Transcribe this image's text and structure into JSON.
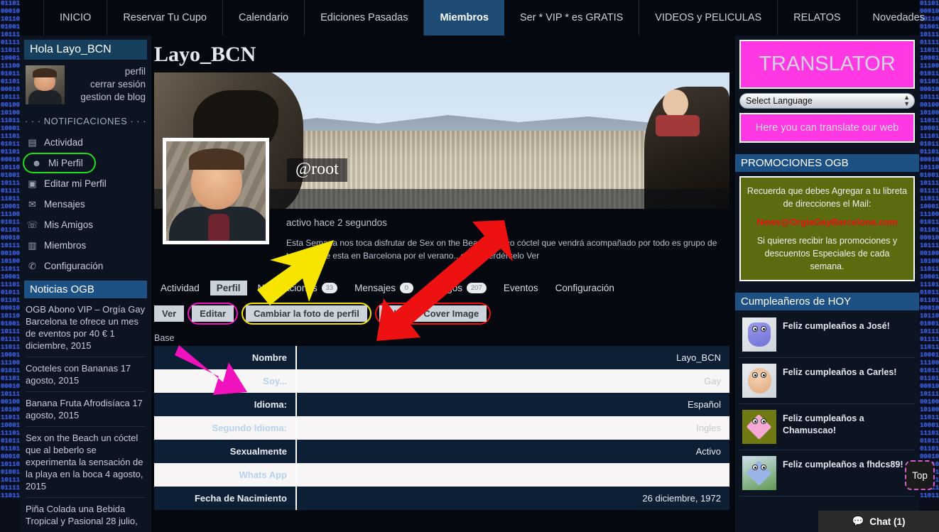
{
  "topnav": {
    "items": [
      {
        "label": "INICIO",
        "active": false
      },
      {
        "label": "Reservar Tu Cupo",
        "active": false
      },
      {
        "label": "Calendario",
        "active": false
      },
      {
        "label": "Ediciones Pasadas",
        "active": false
      },
      {
        "label": "Miembros",
        "active": true
      },
      {
        "label": "Ser * VIP * es GRATIS",
        "active": false
      },
      {
        "label": "VIDEOS y PELICULAS",
        "active": false
      },
      {
        "label": "RELATOS",
        "active": false
      },
      {
        "label": "Novedades",
        "active": false
      }
    ]
  },
  "sidebar": {
    "greeting": "Hola Layo_BCN",
    "user_links": [
      "perfil",
      "cerrar sesión",
      "gestion de blog"
    ],
    "notif_header": "· · · NOTIFICACIONES · · ·",
    "nav": [
      {
        "label": "Actividad",
        "icon": "list-icon",
        "highlight": false
      },
      {
        "label": "Mi Perfil",
        "icon": "user-icon",
        "highlight": true
      },
      {
        "label": "Editar mi Perfil",
        "icon": "id-card-icon",
        "highlight": false
      },
      {
        "label": "Mensajes",
        "icon": "envelope-icon",
        "highlight": false
      },
      {
        "label": "Mis Amigos",
        "icon": "users-icon",
        "highlight": false
      },
      {
        "label": "Miembros",
        "icon": "contacts-icon",
        "highlight": false
      },
      {
        "label": "Configuración",
        "icon": "key-icon",
        "highlight": false
      }
    ],
    "news_header": "Noticias OGB",
    "news": [
      "OGB Abono VIP – Orgía Gay Barcelona te ofrece un mes de eventos por 40 € 1 diciembre, 2015",
      "Cocteles con Bananas 17 agosto, 2015",
      "Banana Fruta Afrodisíaca 17 agosto, 2015",
      "Sex on the Beach un cóctel que al beberlo se experimenta la sensación de la playa en la boca 4 agosto, 2015",
      "Piña Colada una Bebida Tropical y Pasional 28 julio,"
    ]
  },
  "main": {
    "page_title": "Layo_BCN",
    "handle": "@root",
    "active_since": "activo hace 2 segundos",
    "bio": "Esta Semana nos toca disfrutar de Sex on the Beach un rico cóctel que vendrá acompañado por todo es grupo de turistas que esta en Barcelona por el verano.. como perdérselo Ver",
    "tabs": [
      {
        "label": "Actividad",
        "selected": false,
        "badge": null
      },
      {
        "label": "Perfil",
        "selected": true,
        "badge": null
      },
      {
        "label": "Notificaciones",
        "selected": false,
        "badge": "33"
      },
      {
        "label": "Mensajes",
        "selected": false,
        "badge": "0"
      },
      {
        "label": "Amigos",
        "selected": false,
        "badge": "207"
      },
      {
        "label": "Eventos",
        "selected": false,
        "badge": null
      },
      {
        "label": "Configuración",
        "selected": false,
        "badge": null
      }
    ],
    "subbar": [
      {
        "label": "Ver",
        "selected": true,
        "ring": null
      },
      {
        "label": "Editar",
        "selected": false,
        "ring": "magenta"
      },
      {
        "label": "Cambiar la foto de perfil",
        "selected": false,
        "ring": "yellow"
      },
      {
        "label": "Change Cover Image",
        "selected": false,
        "ring": "red"
      }
    ],
    "base_label": "Base",
    "profile_fields": [
      {
        "key": "Nombre",
        "value": "Layo_BCN",
        "style": "dark"
      },
      {
        "key": "Soy...",
        "value": "Gay",
        "style": "light"
      },
      {
        "key": "Idioma:",
        "value": "Español",
        "style": "dark"
      },
      {
        "key": "Segundo Idioma:",
        "value": "Ingles",
        "style": "light"
      },
      {
        "key": "Sexualmente",
        "value": "Activo",
        "style": "dark"
      },
      {
        "key": "Whats App",
        "value": "",
        "style": "light"
      },
      {
        "key": "Fecha de Nacimiento",
        "value": "26 diciembre, 1972",
        "style": "dark"
      }
    ]
  },
  "right": {
    "translator_title": "TRANSLATOR",
    "language_selected": "Select Language",
    "translator_sub": "Here you can translate our web",
    "promo_header": "PROMOCIONES OGB",
    "promo_line1": "Recuerda que debes Agregar a tu libreta de direcciones el Mail:",
    "promo_mail": "News@OrgiaGayBarcelona.com",
    "promo_line2": "Si quieres recibir las promociones y descuentos Especiales de cada semana.",
    "birthday_header": "Cumpleañeros de HOY",
    "birthdays": [
      {
        "text": "Feliz cumpleaños a José!",
        "avatar": "av1"
      },
      {
        "text": "Feliz cumpleaños a Carles!",
        "avatar": "av2"
      },
      {
        "text": "Feliz cumpleaños a Chamuscao!",
        "avatar": "av3"
      },
      {
        "text": "Feliz cumpleaños a fhdcs89!",
        "avatar": "av4"
      }
    ]
  },
  "widgets": {
    "top_button": "Top",
    "chat_label": "Chat (1)"
  },
  "colors": {
    "nav_active": "#1d4b73",
    "section_header": "#1e5183",
    "translator_pink": "#ff38e4",
    "promo_olive": "#5b6b10",
    "promo_mail_red": "#e71212",
    "highlight_green": "#19e01c",
    "ring_magenta": "#f012bd",
    "ring_yellow": "#f7e500",
    "ring_red": "#ef1010"
  },
  "binary_text": "01101\n00010\n10110\n01001\n10111\n01111\n11011\n10001\n11100\n01011\n01101\n00010\n10111\n00100\n10100\n11011\n10001\n11101\n01011\n01101\n00010\n10110\n01001\n10111\n01111\n11011\n10001\n11100\n01011\n01101\n00010\n10111\n00100\n10100\n11011\n10001\n11101\n01011\n01101\n00010\n10110\n01001\n10111\n01111\n11011\n10001\n11100\n01011\n01101\n00010\n10111\n00100\n10100\n11011\n10001\n11101\n01011\n01101\n00010\n10110\n01001\n10111\n01111\n11011"
}
